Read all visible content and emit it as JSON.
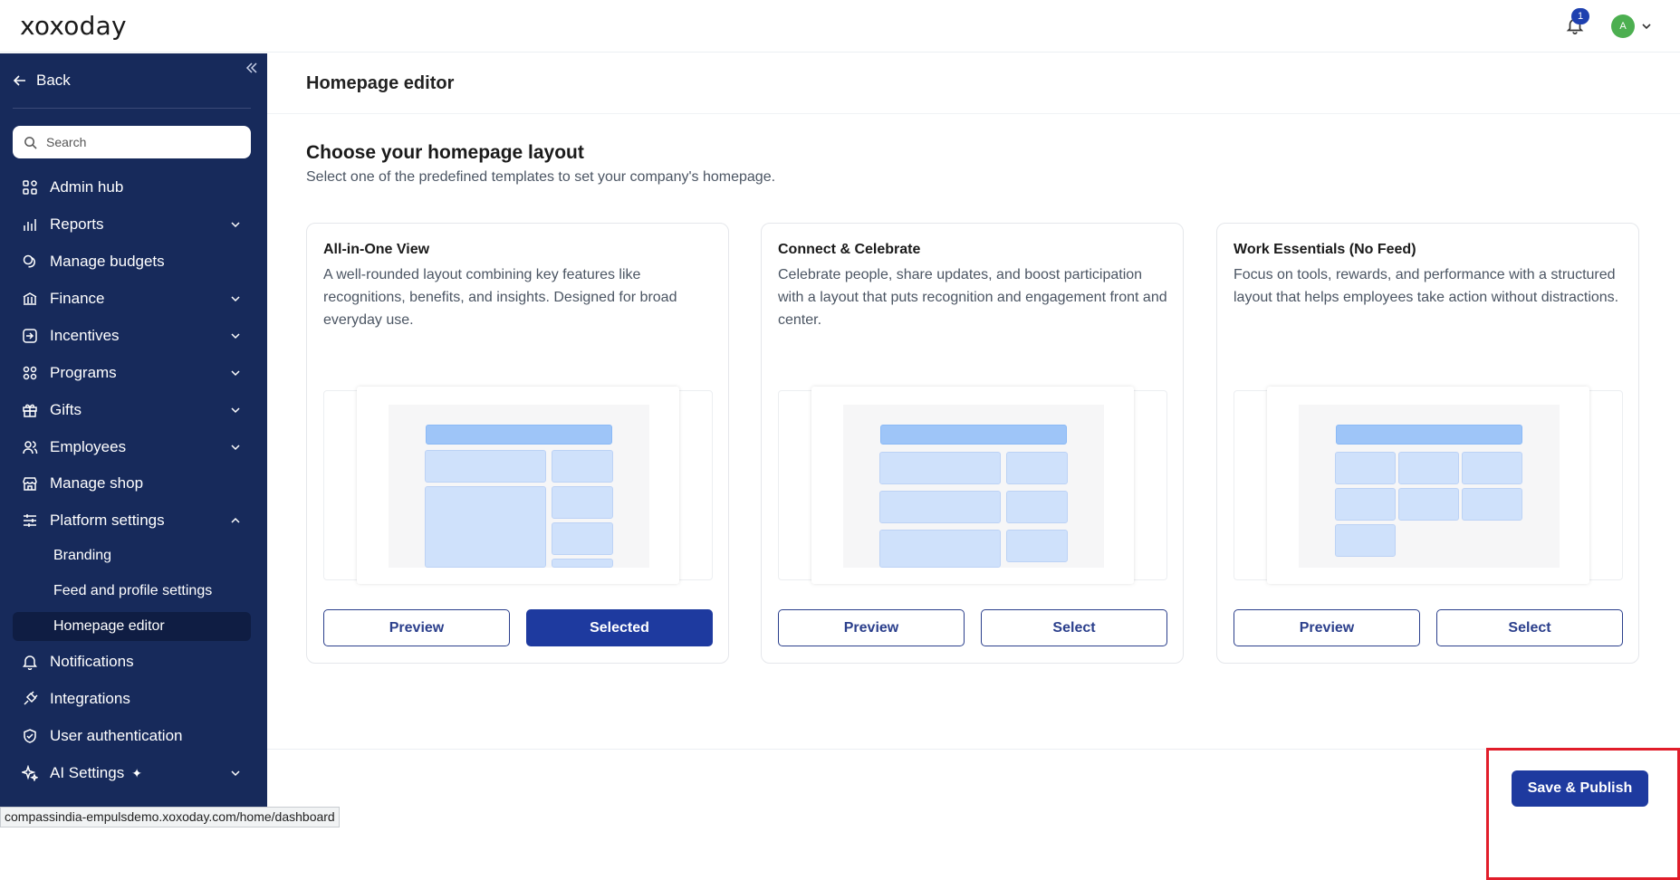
{
  "header": {
    "logo": "xoxoday",
    "notification_count": "1",
    "avatar_initial": "A"
  },
  "sidebar": {
    "back_label": "Back",
    "search_placeholder": "Search",
    "items": [
      {
        "label": "Admin hub",
        "icon": "grid-icon",
        "has_chevron": false
      },
      {
        "label": "Reports",
        "icon": "bar-chart-icon",
        "has_chevron": true
      },
      {
        "label": "Manage budgets",
        "icon": "coins-icon",
        "has_chevron": false
      },
      {
        "label": "Finance",
        "icon": "bank-icon",
        "has_chevron": true
      },
      {
        "label": "Incentives",
        "icon": "login-arrow-icon",
        "has_chevron": true
      },
      {
        "label": "Programs",
        "icon": "nodes-icon",
        "has_chevron": true
      },
      {
        "label": "Gifts",
        "icon": "gift-icon",
        "has_chevron": true
      },
      {
        "label": "Employees",
        "icon": "users-icon",
        "has_chevron": true
      },
      {
        "label": "Manage shop",
        "icon": "store-icon",
        "has_chevron": false
      },
      {
        "label": "Platform settings",
        "icon": "sliders-icon",
        "has_chevron": true,
        "expanded": true
      }
    ],
    "sub_items": [
      {
        "label": "Branding",
        "active": false
      },
      {
        "label": "Feed and profile settings",
        "active": false
      },
      {
        "label": "Homepage editor",
        "active": true
      }
    ],
    "items_after": [
      {
        "label": "Notifications",
        "icon": "bell-icon",
        "has_chevron": false
      },
      {
        "label": "Integrations",
        "icon": "plug-icon",
        "has_chevron": false
      },
      {
        "label": "User authentication",
        "icon": "shield-check-icon",
        "has_chevron": false
      },
      {
        "label": "AI Settings",
        "icon": "sparkles-icon",
        "has_chevron": true
      }
    ]
  },
  "main": {
    "page_title": "Homepage editor",
    "heading": "Choose your homepage layout",
    "subheading": "Select one of the predefined templates to set your company's homepage.",
    "cards": [
      {
        "title": "All-in-One View",
        "description": "A well-rounded layout combining key features like recognitions, benefits, and insights. Designed for broad everyday use.",
        "preview_label": "Preview",
        "select_label": "Selected",
        "selected": true
      },
      {
        "title": "Connect & Celebrate",
        "description": "Celebrate people, share updates, and boost participation with a layout that puts recognition and engagement front and center.",
        "preview_label": "Preview",
        "select_label": "Select",
        "selected": false
      },
      {
        "title": "Work Essentials (No Feed)",
        "description": "Focus on tools, rewards, and performance with a structured layout that helps employees take action without distractions.",
        "preview_label": "Preview",
        "select_label": "Select",
        "selected": false
      }
    ],
    "publish_label": "Save & Publish"
  },
  "status_bar": {
    "url": "compassindia-empulsdemo.xoxoday.com/home/dashboard"
  },
  "colors": {
    "sidebar_bg": "#172a5b",
    "primary": "#1e3a9f",
    "highlight": "#e11d2a"
  }
}
